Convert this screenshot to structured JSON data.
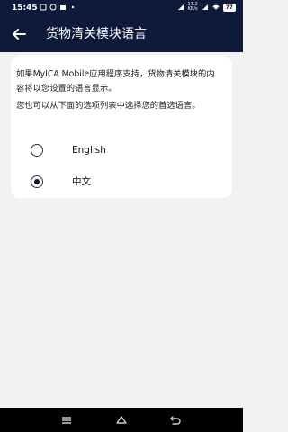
{
  "status_bar": {
    "time": "15:45",
    "net_speed_value": "17.2",
    "net_speed_unit": "KB/s",
    "battery": "77"
  },
  "app_bar": {
    "title": "货物清关模块语言"
  },
  "content": {
    "description_1": "如果MyICA Mobile应用程序支持，货物清关模块的内容将以您设置的语言显示。",
    "description_2": "您也可以从下面的选项列表中选择您的首选语言。",
    "options": [
      {
        "label": "English",
        "selected": false
      },
      {
        "label": "中文",
        "selected": true
      }
    ]
  },
  "colors": {
    "primary": "#0d1a3a",
    "background": "#f2f2f2",
    "card": "#ffffff"
  },
  "icons": {
    "back": "arrow-left-icon",
    "nav_menu": "menu-icon",
    "nav_home": "home-icon",
    "nav_back": "back-icon"
  }
}
